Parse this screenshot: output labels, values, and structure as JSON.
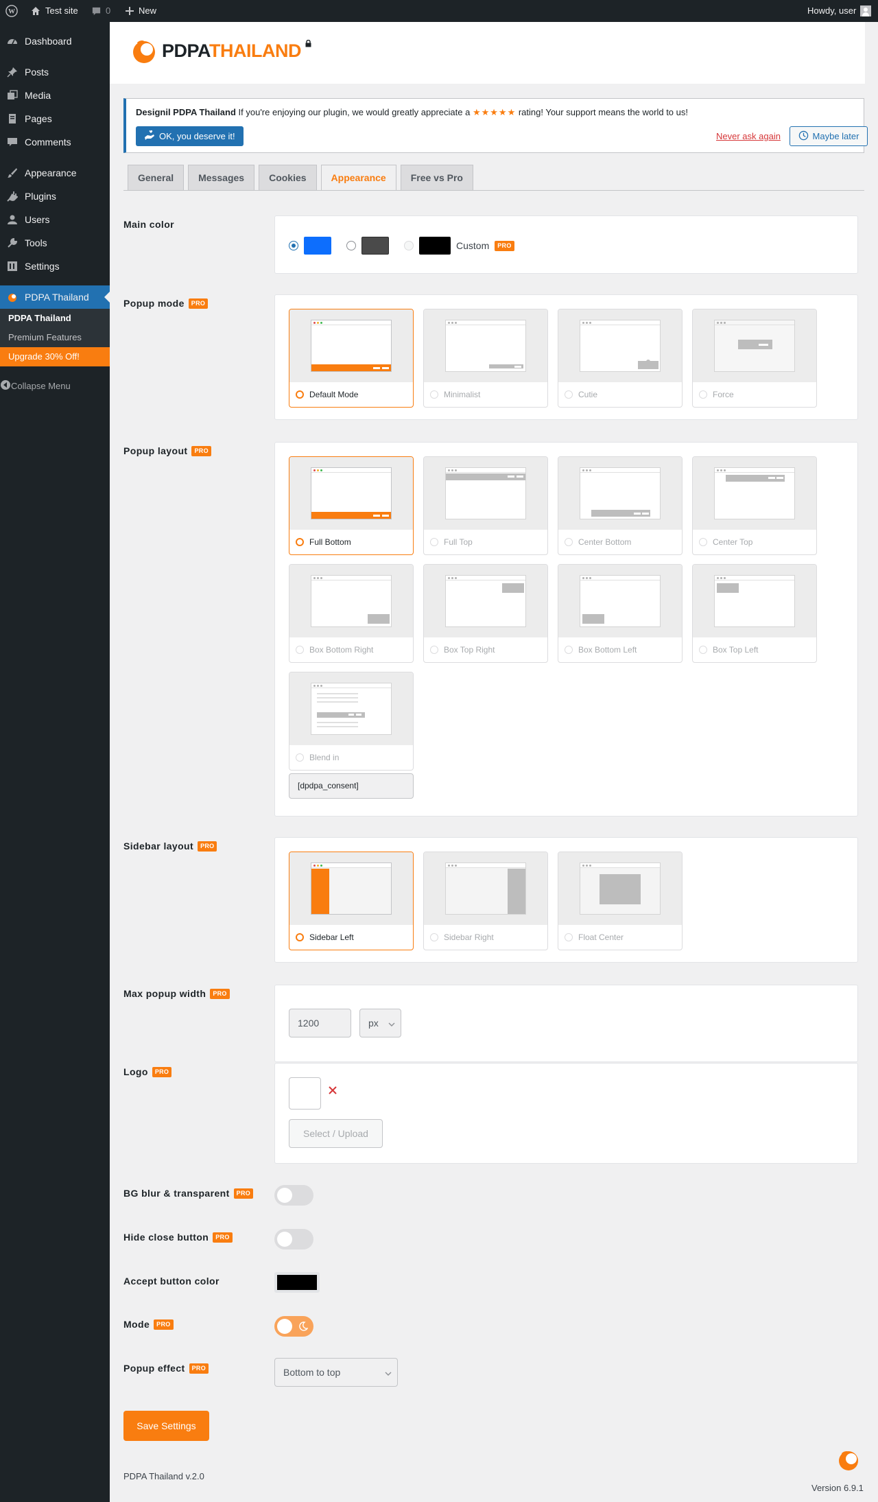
{
  "admin_bar": {
    "site_name": "Test site",
    "comments_count": "0",
    "new_label": "New",
    "howdy": "Howdy, user",
    "icons": [
      "wordpress-icon",
      "home-icon",
      "comment-icon",
      "plus-icon",
      "avatar"
    ]
  },
  "sidebar": {
    "items": [
      {
        "label": "Dashboard",
        "icon": "dashboard-icon"
      },
      {
        "label": "Posts",
        "icon": "pin-icon"
      },
      {
        "label": "Media",
        "icon": "media-icon"
      },
      {
        "label": "Pages",
        "icon": "pages-icon"
      },
      {
        "label": "Comments",
        "icon": "comment-icon"
      },
      {
        "label": "Appearance",
        "icon": "brush-icon"
      },
      {
        "label": "Plugins",
        "icon": "plug-icon"
      },
      {
        "label": "Users",
        "icon": "user-icon"
      },
      {
        "label": "Tools",
        "icon": "wrench-icon"
      },
      {
        "label": "Settings",
        "icon": "settings-icon"
      },
      {
        "label": "PDPA Thailand",
        "icon": "pdpa-logo-icon"
      }
    ],
    "submenu": [
      "PDPA Thailand",
      "Premium Features",
      "Upgrade 30% Off!"
    ],
    "collapse": "Collapse Menu"
  },
  "header": {
    "logo_part1": "PDPA",
    "logo_part2": "THAILAND"
  },
  "notice": {
    "plugin_name": "Designil PDPA Thailand",
    "text_before": " If you're enjoying our plugin, we would greatly appreciate a ",
    "stars": "★★★★★",
    "text_after": " rating! Your support means the world to us!",
    "ok_button": "OK, you deserve it!",
    "never_link": "Never ask again",
    "later_button": "Maybe later"
  },
  "tabs": [
    "General",
    "Messages",
    "Cookies",
    "Appearance",
    "Free vs Pro"
  ],
  "active_tab": "Appearance",
  "pro_badge": "PRO",
  "main_color": {
    "label": "Main color",
    "options": [
      "#0d6efd",
      "#4a4a4a",
      "#000000"
    ],
    "custom_label": "Custom"
  },
  "popup_mode": {
    "label": "Popup mode",
    "options": [
      "Default Mode",
      "Minimalist",
      "Cutie",
      "Force"
    ]
  },
  "popup_layout": {
    "label": "Popup layout",
    "options": [
      "Full Bottom",
      "Full Top",
      "Center Bottom",
      "Center Top",
      "Box Bottom Right",
      "Box Top Right",
      "Box Bottom Left",
      "Box Top Left",
      "Blend in"
    ],
    "shortcode": "[dpdpa_consent]"
  },
  "sidebar_layout": {
    "label": "Sidebar layout",
    "options": [
      "Sidebar Left",
      "Sidebar Right",
      "Float Center"
    ]
  },
  "max_width": {
    "label": "Max popup width",
    "value": "1200",
    "unit": "px"
  },
  "logo": {
    "label": "Logo",
    "upload_button": "Select / Upload"
  },
  "bg_blur": {
    "label": "BG blur & transparent"
  },
  "hide_close": {
    "label": "Hide close button"
  },
  "accept_color": {
    "label": "Accept button color",
    "value": "#000000"
  },
  "mode": {
    "label": "Mode"
  },
  "popup_effect": {
    "label": "Popup effect",
    "value": "Bottom to top"
  },
  "save_button": "Save Settings",
  "footer": {
    "plugin_version": "PDPA Thailand v.2.0",
    "wp_version": "Version 6.9.1"
  },
  "colors": {
    "accent": "#f97d10",
    "wp_blue": "#2271b1",
    "admin_dark": "#1d2327"
  }
}
